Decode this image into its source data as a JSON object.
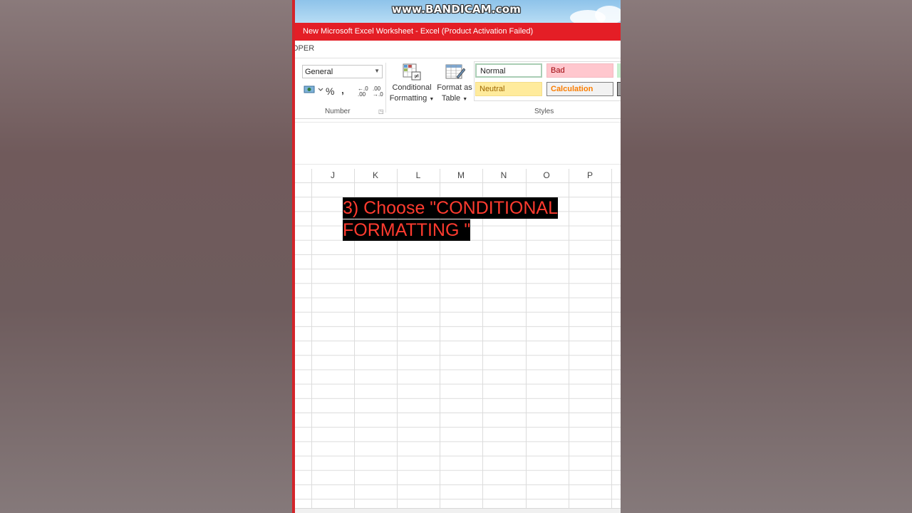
{
  "watermark": "www.BANDICAM.com",
  "window": {
    "title": "New Microsoft Excel Worksheet -  Excel (Product Activation Failed)"
  },
  "ribbon_tab_fragment": "OPER",
  "number_group": {
    "format_value": "General",
    "label": "Number",
    "percent": "%",
    "comma": "‚",
    "increase_decimal": "←.0\n.00",
    "decrease_decimal": ".00\n→.0"
  },
  "conditional_formatting": {
    "line1": "Conditional",
    "line2": "Formatting"
  },
  "format_as_table": {
    "line1": "Format as",
    "line2": "Table"
  },
  "styles": {
    "label": "Styles",
    "normal": "Normal",
    "bad": "Bad",
    "neutral": "Neutral",
    "calculation": "Calculation"
  },
  "columns": [
    "J",
    "K",
    "L",
    "M",
    "N",
    "O",
    "P"
  ],
  "overlay": {
    "line1": "3) Choose \"CONDITIONAL",
    "line2": "FORMATTING \""
  },
  "colors": {
    "title_bar": "#e41e26",
    "overlay_text": "#ff3b2f",
    "bad_fill": "#ffc7ce",
    "neutral_fill": "#ffeb9c",
    "calculation_text": "#fa7d00"
  }
}
